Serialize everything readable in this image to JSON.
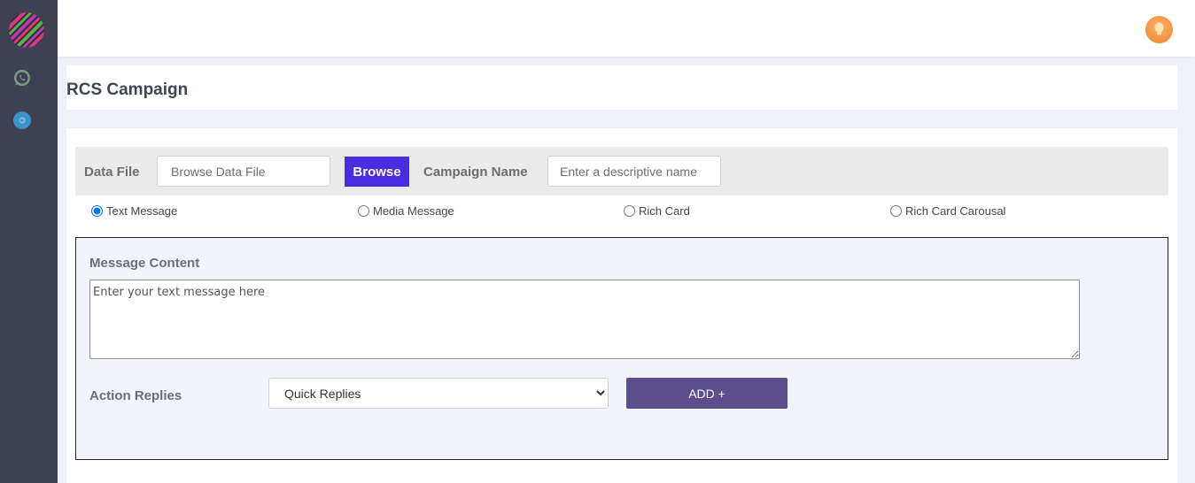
{
  "sidebar": {
    "logo": "striped-circle-logo",
    "items": [
      {
        "icon": "whatsapp-icon",
        "color": "#7d9a85"
      },
      {
        "icon": "rcs-icon",
        "color": "#3a93c9"
      }
    ]
  },
  "topbar": {
    "avatar_icon": "user-avatar",
    "avatar_color": "#f49a44"
  },
  "page": {
    "title": "RCS Campaign"
  },
  "filebar": {
    "data_file_label": "Data File",
    "data_file_placeholder": "Browse Data File",
    "browse_label": "Browse",
    "campaign_name_label": "Campaign Name",
    "campaign_name_placeholder": "Enter a descriptive name"
  },
  "message_types": {
    "selected": "Text Message",
    "options": [
      "Text Message",
      "Media Message",
      "Rich Card",
      "Rich Card Carousal"
    ]
  },
  "content": {
    "message_label": "Message Content",
    "message_placeholder": "Enter your text message here",
    "action_replies_label": "Action Replies",
    "action_select_value": "Quick Replies",
    "add_label": "ADD +"
  },
  "colors": {
    "browse_button": "#4a2ce0",
    "add_button": "#5b4e8d",
    "sidebar": "#3e4152"
  }
}
